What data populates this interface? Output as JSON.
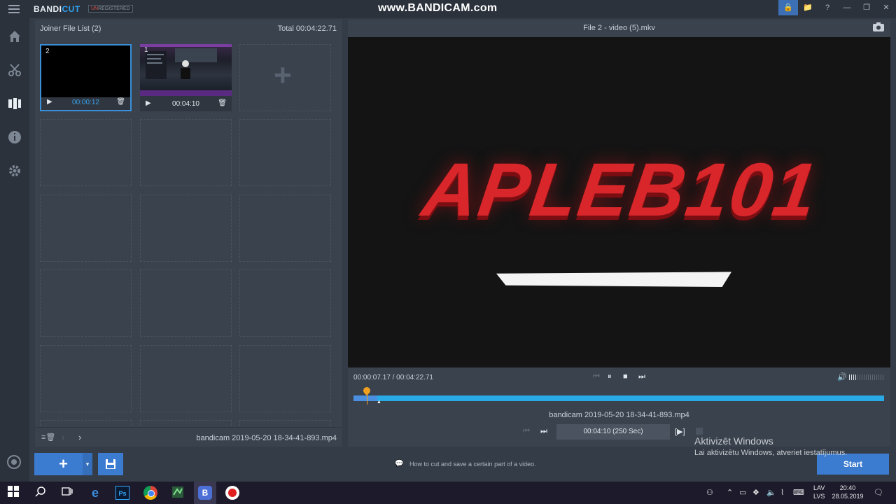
{
  "app": {
    "logo_main": "BANDI",
    "logo_accent": "CUT",
    "unregistered_prefix": "UN",
    "unregistered_rest": "REGISTERED",
    "watermark": "www.BANDICAM.com"
  },
  "window_icons": [
    "🔒",
    "📁",
    "?",
    "—",
    "❐",
    "✕"
  ],
  "left_panel": {
    "title": "Joiner File List (2)",
    "total": "Total 00:04:22.71",
    "clips": [
      {
        "number": "2",
        "duration": "00:00:12",
        "selected": true
      },
      {
        "number": "1",
        "duration": "00:04:10",
        "selected": false
      }
    ],
    "add_symbol": "+",
    "footer_file": "bandicam 2019-05-20 18-34-41-893.mp4"
  },
  "right_panel": {
    "file_title": "File 2 - video (5).mkv",
    "video_text": "APLEB101",
    "time_display": "00:00:07.17 / 00:04:22.71",
    "segment_file": "bandicam 2019-05-20 18-34-41-893.mp4",
    "segment_duration": "00:04:10  (250 Sec)",
    "playhead_fraction": 0.027
  },
  "bottom": {
    "add_label": "+",
    "tip": "How to cut and save a certain part of a video.",
    "start_label": "Start",
    "activation_title": "Aktivizēt Windows",
    "activation_sub": "Lai aktivizētu Windows, atveriet iestatījumus."
  },
  "taskbar": {
    "ps_label": "Ps",
    "bandi_label": "B",
    "lang_top": "LAV",
    "lang_bottom": "LVS",
    "time": "20:40",
    "date": "28.05.2019"
  },
  "colors": {
    "accent": "#3b7bd0",
    "timeline": "#29a9e6",
    "playhead": "#f0a020",
    "title_red": "#d8262a"
  }
}
